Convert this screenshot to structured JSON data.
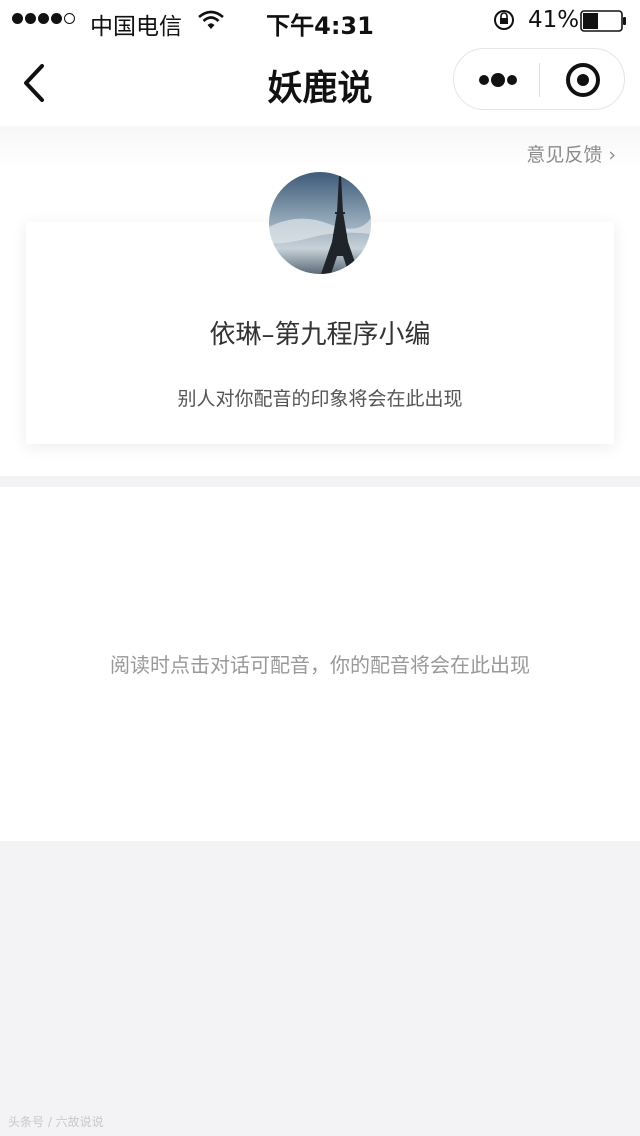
{
  "status_bar": {
    "carrier": "中国电信",
    "time": "下午4:31",
    "battery": "41%",
    "battery_level": 0.41
  },
  "nav": {
    "title": "妖鹿说"
  },
  "feedback": {
    "label": "意见反馈 ›"
  },
  "profile": {
    "name": "依琳–第九程序小编",
    "impression_placeholder": "别人对你配音的印象将会在此出现"
  },
  "dubbing": {
    "empty_message": "阅读时点击对话可配音，你的配音将会在此出现"
  },
  "watermark": {
    "text": "头条号 / 六故说说"
  },
  "icons": {
    "back": "chevron-left-icon",
    "more": "more-dots-icon",
    "close": "target-close-icon",
    "wifi": "wifi-icon",
    "lock": "rotation-lock-icon",
    "battery": "battery-icon"
  }
}
